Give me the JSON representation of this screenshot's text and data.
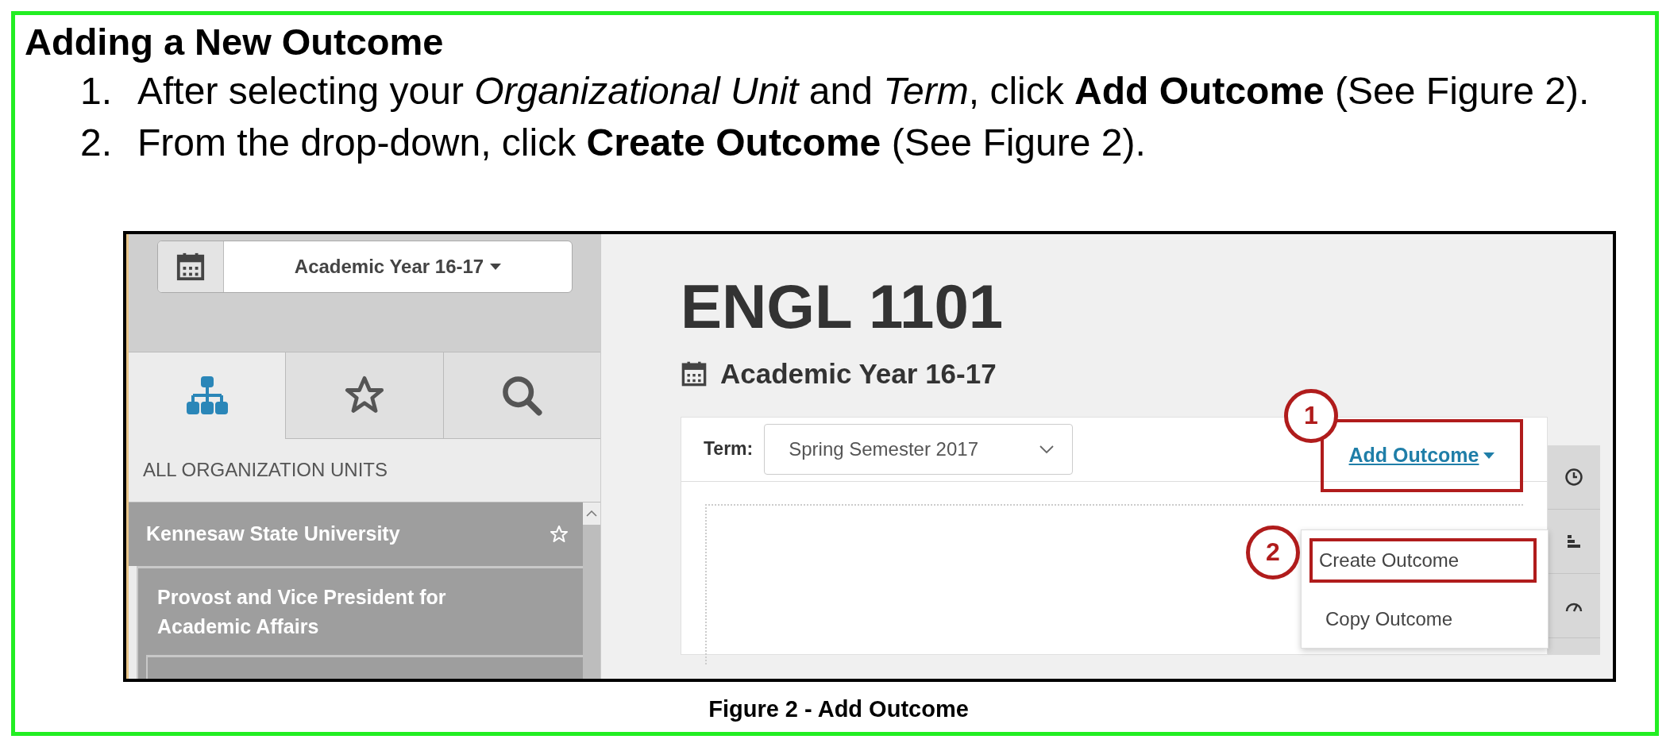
{
  "heading": "Adding a New Outcome",
  "steps": [
    {
      "number": "1.",
      "text": "After selecting your *Organizational Unit* and *Term*, click **Add Outcome** (See Figure 2)."
    },
    {
      "number": "2.",
      "text": "From the drop-down, click **Create Outcome** (See Figure 2)."
    }
  ],
  "figure": {
    "caption": "Figure 2 - Add Outcome",
    "sidebar": {
      "year_selector": "Academic Year 16-17",
      "tabs": [
        {
          "kind": "hierarchy",
          "selected": true
        },
        {
          "kind": "star",
          "selected": false
        },
        {
          "kind": "search",
          "selected": false
        }
      ],
      "section_label": "ALL ORGANIZATION UNITS",
      "tree": [
        {
          "label": "Kennesaw State University",
          "children": [
            {
              "label": "Provost and Vice President for Academic Affairs"
            }
          ]
        }
      ]
    },
    "main": {
      "title": "ENGL 1101",
      "subtitle": "Academic Year 16-17",
      "term_label": "Term:",
      "term_value": "Spring Semester 2017",
      "add_outcome": {
        "label": "Add Outcome",
        "callout": "1"
      },
      "menu": [
        {
          "label": "Create Outcome",
          "callout": "2"
        },
        {
          "label": "Copy Outcome"
        }
      ]
    }
  }
}
